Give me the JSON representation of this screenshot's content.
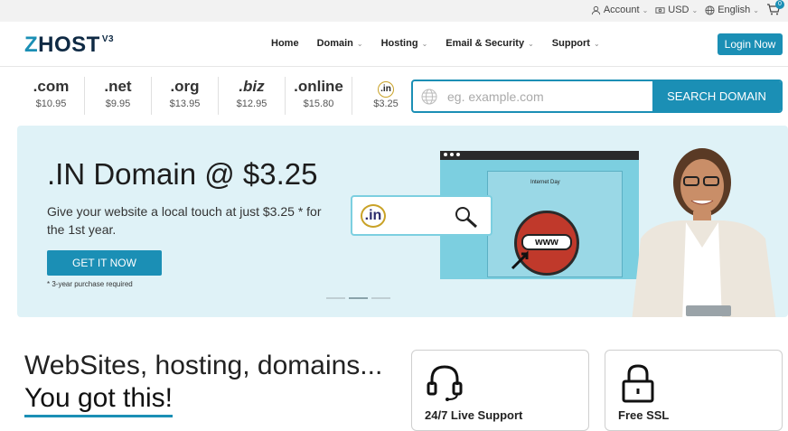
{
  "topbar": {
    "account": "Account",
    "currency": "USD",
    "language": "English",
    "cart_count": "0"
  },
  "nav": {
    "logo_main": "HOST",
    "logo_z": "Z",
    "logo_version": "V3",
    "menu": [
      {
        "label": "Home"
      },
      {
        "label": "Domain"
      },
      {
        "label": "Hosting"
      },
      {
        "label": "Email & Security"
      },
      {
        "label": "Support"
      }
    ],
    "login": "Login Now"
  },
  "tlds": [
    {
      "name": ".com",
      "price": "$10.95"
    },
    {
      "name": ".net",
      "price": "$9.95"
    },
    {
      "name": ".org",
      "price": "$13.95"
    },
    {
      "name": ".biz",
      "price": "$12.95"
    },
    {
      "name": ".online",
      "price": "$15.80"
    },
    {
      "name": ".in",
      "price": "$3.25"
    }
  ],
  "search": {
    "placeholder": "eg. example.com",
    "button": "SEARCH DOMAIN"
  },
  "hero": {
    "title": ".IN Domain @ $3.25",
    "subtitle": "Give your website a local touch at just $3.25 * for the 1st year.",
    "cta": "GET IT NOW",
    "note": "* 3-year purchase required",
    "illustration_label": "Internet Day",
    "www": "www",
    "mini_in": ".in",
    "active_slide": 2,
    "slide_count": 3
  },
  "bottom": {
    "tagline_1": "WebSites, hosting, domains...",
    "tagline_2": "You got this!",
    "features": [
      {
        "label": "24/7 Live Support",
        "icon": "headset-icon"
      },
      {
        "label": "Free SSL",
        "icon": "lock-icon"
      }
    ]
  },
  "colors": {
    "accent": "#1b8fb5",
    "hero_bg": "#dff2f7",
    "logo_dark": "#0f2a44"
  }
}
